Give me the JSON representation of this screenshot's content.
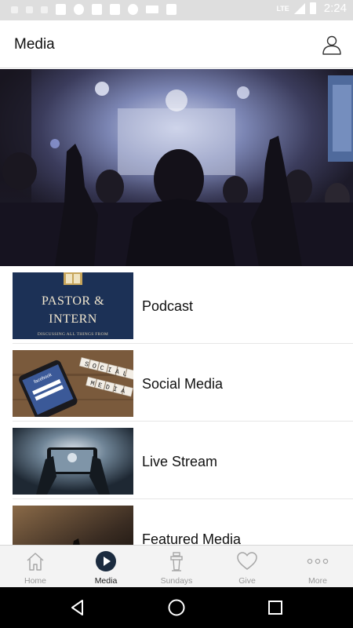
{
  "status_bar": {
    "network": "LTE",
    "time": "2:24"
  },
  "app_bar": {
    "title": "Media",
    "profile_icon": "user-icon"
  },
  "hero": {
    "icon": "concert-worship-image"
  },
  "media_items": [
    {
      "label": "Podcast",
      "thumb_lines": [
        "PASTOR &",
        "INTERN"
      ],
      "thumb_subtitle": "DISCUSSING ALL THINGS FROM"
    },
    {
      "label": "Social Media",
      "thumb_tiles": [
        "SOCIAL",
        "MEDIA"
      ],
      "thumb_screen_text": "facebook"
    },
    {
      "label": "Live Stream"
    },
    {
      "label": "Featured Media"
    }
  ],
  "bottom_nav": [
    {
      "label": "Home",
      "icon": "home-icon",
      "active": false
    },
    {
      "label": "Media",
      "icon": "play-circle-icon",
      "active": true
    },
    {
      "label": "Sundays",
      "icon": "podium-icon",
      "active": false
    },
    {
      "label": "Give",
      "icon": "heart-icon",
      "active": false
    },
    {
      "label": "More",
      "icon": "more-dots-icon",
      "active": false
    }
  ],
  "system_nav": [
    "back-icon",
    "home-circle-icon",
    "recents-icon"
  ],
  "colors": {
    "accent": "#1b2b3f",
    "status_bar": "#dedede",
    "nav_inactive": "#9a9a9a"
  }
}
